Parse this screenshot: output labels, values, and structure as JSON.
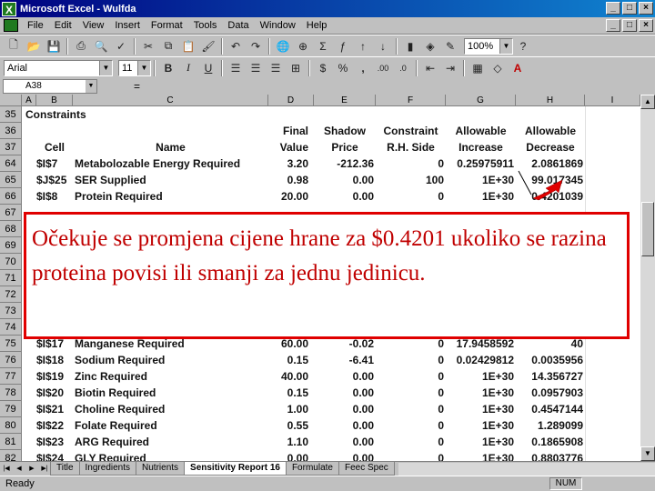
{
  "window": {
    "title": "Microsoft Excel - Wulfda"
  },
  "menu": [
    "File",
    "Edit",
    "View",
    "Insert",
    "Format",
    "Tools",
    "Data",
    "Window",
    "Help"
  ],
  "toolbar": {
    "zoom": "100%",
    "font": "Arial",
    "size": "11"
  },
  "formula": {
    "cell_ref": "A38",
    "equals": "="
  },
  "columns": [
    "A",
    "B",
    "C",
    "D",
    "E",
    "F",
    "G",
    "H",
    "I"
  ],
  "section_title": "Constraints",
  "header1": {
    "final": "Final",
    "shadow": "Shadow",
    "constraint": "Constraint",
    "allowable_inc": "Allowable",
    "allowable_dec": "Allowable"
  },
  "header2": {
    "rownum1": "36",
    "rownum2": "37",
    "cell": "Cell",
    "name": "Name",
    "value": "Value",
    "price": "Price",
    "rhs": "R.H. Side",
    "increase": "Increase",
    "decrease": "Decrease"
  },
  "rows": [
    {
      "n": "64",
      "cell": "$I$7",
      "name": "Metabolozable Energy Required",
      "final": "3.20",
      "shadow": "-212.36",
      "rhs": "0",
      "inc": "0.25975911",
      "dec": "2.0861869"
    },
    {
      "n": "65",
      "cell": "$J$25",
      "name": "SER Supplied",
      "final": "0.98",
      "shadow": "0.00",
      "rhs": "100",
      "inc": "1E+30",
      "dec": "99.017345"
    },
    {
      "n": "66",
      "cell": "$I$8",
      "name": "Protein Required",
      "final": "20.00",
      "shadow": "0.00",
      "rhs": "0",
      "inc": "1E+30",
      "dec": "0.4201039"
    },
    {
      "n": "75",
      "cell": "$I$17",
      "name": "Manganese Required",
      "final": "60.00",
      "shadow": "-0.02",
      "rhs": "0",
      "inc": "17.9458592",
      "dec": "40"
    },
    {
      "n": "76",
      "cell": "$I$18",
      "name": "Sodium Required",
      "final": "0.15",
      "shadow": "-6.41",
      "rhs": "0",
      "inc": "0.02429812",
      "dec": "0.0035956"
    },
    {
      "n": "77",
      "cell": "$I$19",
      "name": "Zinc Required",
      "final": "40.00",
      "shadow": "0.00",
      "rhs": "0",
      "inc": "1E+30",
      "dec": "14.356727"
    },
    {
      "n": "78",
      "cell": "$I$20",
      "name": "Biotin Required",
      "final": "0.15",
      "shadow": "0.00",
      "rhs": "0",
      "inc": "1E+30",
      "dec": "0.0957903"
    },
    {
      "n": "79",
      "cell": "$I$21",
      "name": "Choline Required",
      "final": "1.00",
      "shadow": "0.00",
      "rhs": "0",
      "inc": "1E+30",
      "dec": "0.4547144"
    },
    {
      "n": "80",
      "cell": "$I$22",
      "name": "Folate Required",
      "final": "0.55",
      "shadow": "0.00",
      "rhs": "0",
      "inc": "1E+30",
      "dec": "1.289099"
    },
    {
      "n": "81",
      "cell": "$I$23",
      "name": "ARG Required",
      "final": "1.10",
      "shadow": "0.00",
      "rhs": "0",
      "inc": "1E+30",
      "dec": "0.1865908"
    },
    {
      "n": "82",
      "cell": "$I$24",
      "name": "GLY Required",
      "final": "0.00",
      "shadow": "0.00",
      "rhs": "0",
      "inc": "1E+30",
      "dec": "0.8803776"
    }
  ],
  "hidden_row_numbers": [
    "67",
    "68",
    "69",
    "70",
    "71",
    "72",
    "73",
    "74"
  ],
  "callout": {
    "text": "Očekuje se promjena cijene hrane za $0.4201 ukoliko se razina proteina povisi ili smanji za jednu jedinicu."
  },
  "tabs": [
    "Title",
    "Ingredients",
    "Nutrients",
    "Sensitivity Report 16",
    "Formulate",
    "Feec Spec"
  ],
  "active_tab": "Sensitivity Report 16",
  "status": {
    "ready": "Ready",
    "num": "NUM"
  },
  "colors": {
    "title_bar": "#000080",
    "callout_border": "#e00000",
    "callout_text": "#c00000"
  }
}
